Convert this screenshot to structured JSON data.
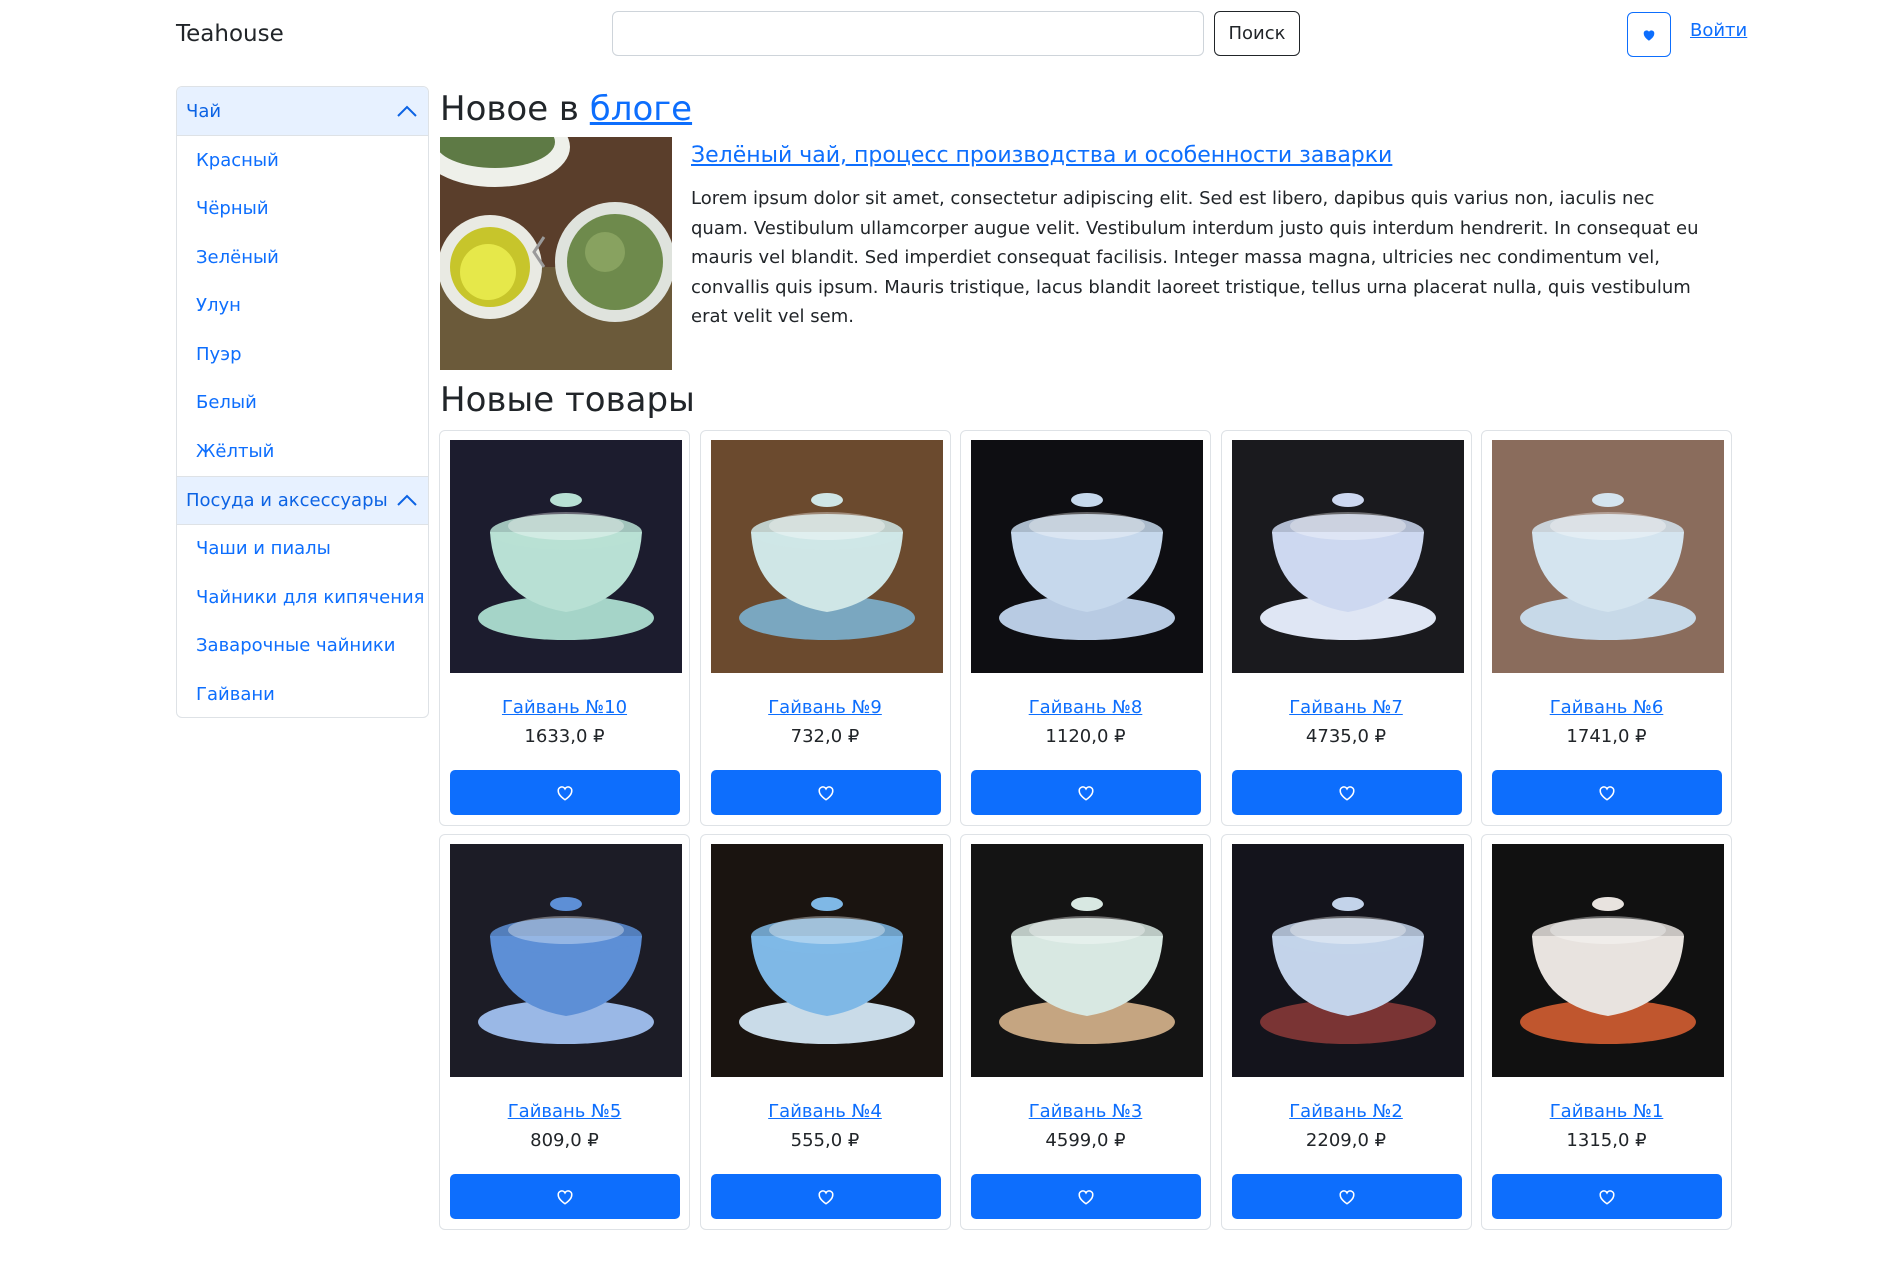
{
  "header": {
    "brand": "Teahouse",
    "search_placeholder": "",
    "search_button": "Поиск",
    "favorites_icon": "heart-fill-icon",
    "login": "Войти"
  },
  "sidebar": {
    "sections": [
      {
        "title": "Чай",
        "expanded": true,
        "items": [
          "Красный",
          "Чёрный",
          "Зелёный",
          "Улун",
          "Пуэр",
          "Белый",
          "Жёлтый"
        ]
      },
      {
        "title": "Посуда и аксессуары",
        "expanded": true,
        "items": [
          "Чаши и пиалы",
          "Чайники для кипячения",
          "Заварочные чайники",
          "Гайвани"
        ]
      }
    ]
  },
  "blog": {
    "heading_prefix": "Новое в ",
    "heading_link": "блоге",
    "post_title": "Зелёный чай, процесс производства и особенности заварки",
    "post_text": "Lorem ipsum dolor sit amet, consectetur adipiscing elit. Sed est libero, dapibus quis varius non, iaculis nec quam. Vestibulum ullamcorper augue velit. Vestibulum interdum justo quis interdum hendrerit. In consequat eu mauris vel blandit. Sed imperdiet consequat facilisis. Integer massa magna, ultricies nec condimentum vel, convallis quis ipsum. Mauris tristique, lacus blandit laoreet tristique, tellus urna placerat nulla, quis vestibulum erat velit vel sem."
  },
  "products": {
    "heading": "Новые товары",
    "favorite_icon": "heart-outline-icon",
    "items": [
      {
        "name": "Гайвань №10",
        "price": "1633,0 ₽",
        "bg": "#1c1c2e",
        "body": "#b8e0d4",
        "saucer": "#a5d4c8"
      },
      {
        "name": "Гайвань №9",
        "price": "732,0 ₽",
        "bg": "#6b4a2e",
        "body": "#cfe6e6",
        "saucer": "#7aa7c0"
      },
      {
        "name": "Гайвань №8",
        "price": "1120,0 ₽",
        "bg": "#0e0e12",
        "body": "#c6d8ec",
        "saucer": "#b8cbe3"
      },
      {
        "name": "Гайвань №7",
        "price": "4735,0 ₽",
        "bg": "#1a1a1e",
        "body": "#cdd8f0",
        "saucer": "#dfe6f4"
      },
      {
        "name": "Гайвань №6",
        "price": "1741,0 ₽",
        "bg": "#8a6c5c",
        "body": "#d4e4ef",
        "saucer": "#c7d9e8"
      },
      {
        "name": "Гайвань №5",
        "price": "809,0 ₽",
        "bg": "#1c1c26",
        "body": "#5d8fd6",
        "saucer": "#9ab8e6"
      },
      {
        "name": "Гайвань №4",
        "price": "555,0 ₽",
        "bg": "#1a1410",
        "body": "#7fb8e6",
        "saucer": "#c9dbe8"
      },
      {
        "name": "Гайвань №3",
        "price": "4599,0 ₽",
        "bg": "#141414",
        "body": "#d8e8e2",
        "saucer": "#c5a581"
      },
      {
        "name": "Гайвань №2",
        "price": "2209,0 ₽",
        "bg": "#14141c",
        "body": "#c3d3ea",
        "saucer": "#7a3434"
      },
      {
        "name": "Гайвань №1",
        "price": "1315,0 ₽",
        "bg": "#111111",
        "body": "#e8e3df",
        "saucer": "#c0562e"
      }
    ]
  }
}
